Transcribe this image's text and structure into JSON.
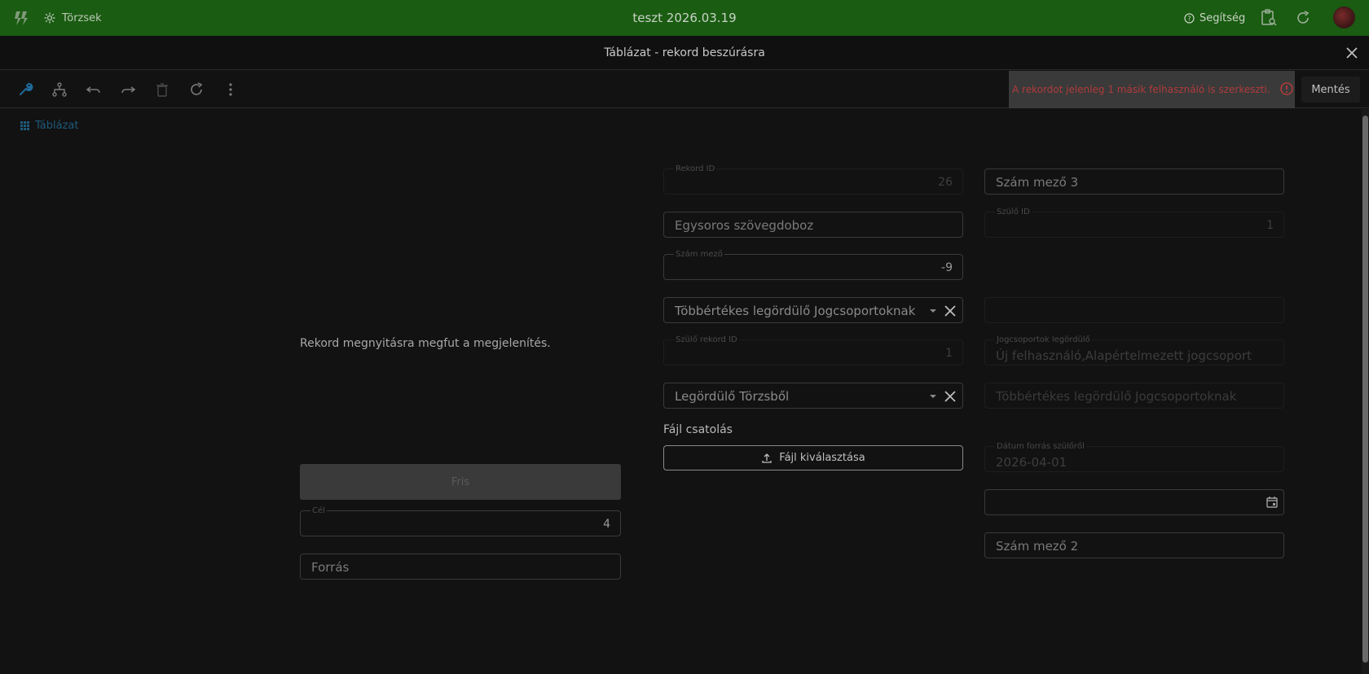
{
  "appbar": {
    "logo_icon": "lightning-logo-icon",
    "torzsek_label": "Törzsek",
    "title": "teszt 2026.03.19",
    "help_label": "Segítség"
  },
  "dialog": {
    "title": "Táblázat - rekord beszúrásra"
  },
  "toolbar": {
    "alert_text": "A rekordot jelenleg 1 másik felhasználó is szerkeszti.",
    "save_label": "Mentés"
  },
  "breadcrumb": {
    "label": "Táblázat"
  },
  "left": {
    "message": "Rekord megnyitásra megfut a megjelenítés.",
    "fris_label": "Fris",
    "cel": {
      "label": "Cél",
      "value": "4"
    },
    "forras": {
      "placeholder": "Forrás"
    }
  },
  "middle": {
    "rekord_id": {
      "label": "Rekord ID",
      "value": "26"
    },
    "egysoros": {
      "placeholder": "Egysoros szövegdoboz"
    },
    "szam_mezo": {
      "label": "Szám mező",
      "value": "-9"
    },
    "tobbertekes": {
      "placeholder": "Többértékes legördülő Jogcsoportoknak"
    },
    "szulo_rekord_id": {
      "label": "Szülő rekord ID",
      "value": "1"
    },
    "legordulo_torzsbol": {
      "placeholder": "Legördülő Törzsből"
    },
    "fajl_csatolas_label": "Fájl csatolás",
    "fajl_button_label": "Fájl kiválasztása"
  },
  "right": {
    "szam_mezo_3": {
      "placeholder": "Szám mező 3"
    },
    "szulo_id": {
      "label": "Szülő ID",
      "value": "1"
    },
    "jogcsoportok": {
      "label": "Jogcsoportok legördülő",
      "value": "Új felhasználó,Alapértelmezett jogcsoport"
    },
    "tobbertekes": {
      "placeholder": "Többértékes legördülő Jogcsoportoknak"
    },
    "datum_forras": {
      "label": "Dátum forrás szülőről",
      "value": "2026-04-01"
    },
    "szam_mezo_2": {
      "placeholder": "Szám mező 2"
    }
  },
  "colors": {
    "appbar_bg": "#1a5c12",
    "alert_text": "#b03a3a",
    "breadcrumb": "#1e5a7a"
  }
}
